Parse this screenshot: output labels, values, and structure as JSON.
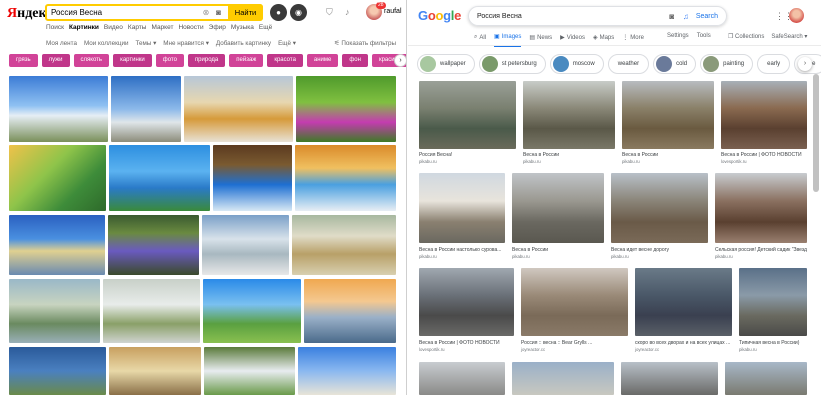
{
  "yandex": {
    "logo_first": "Я",
    "logo_rest": "ндекс",
    "search_value": "Россия Весна",
    "search_button": "Найти",
    "user_name": "raufal",
    "notification_count": "28",
    "services": [
      "Поиск",
      "Картинки",
      "Видео",
      "Карты",
      "Маркет",
      "Новости",
      "Эфир",
      "Музыка",
      "Ещё"
    ],
    "subnav": [
      "Моя лента",
      "Мои коллекции",
      "Темы ▾",
      "Мне нравится ▾",
      "Добавить картинку",
      "Ещё ▾"
    ],
    "filters_label": "Показать фильтры",
    "tags": [
      "грязь",
      "лужи",
      "слякоть",
      "картинки",
      "фото",
      "природа",
      "пейзаж",
      "красота",
      "аниме",
      "фон",
      "красивые"
    ],
    "arrow": "›"
  },
  "google": {
    "logo": [
      "G",
      "o",
      "o",
      "g",
      "l",
      "e"
    ],
    "logo_colors": [
      "#4285f4",
      "#ea4335",
      "#fbbc05",
      "#4285f4",
      "#34a853",
      "#ea4335"
    ],
    "search_value": "Россия Весна",
    "search_button": "Search",
    "tabs": [
      "All",
      "Images",
      "News",
      "Videos",
      "Maps",
      "More"
    ],
    "settings": "Settings",
    "tools": "Tools",
    "collections": "Collections",
    "safesearch": "SafeSearch ▾",
    "chips": [
      "wallpaper",
      "st petersburg",
      "moscow",
      "weather",
      "cold",
      "painting",
      "early",
      "time"
    ],
    "results": [
      {
        "caption": "Россия Весна!",
        "source": "pikabu.ru"
      },
      {
        "caption": "Весна в России",
        "source": "pikabu.ru"
      },
      {
        "caption": "Весна в России",
        "source": "pikabu.ru"
      },
      {
        "caption": "Весна в России | ФОТО НОВОСТИ",
        "source": "lovesportik.ru"
      },
      {
        "caption": "Весна в России настолько сурова...",
        "source": "pikabu.ru"
      },
      {
        "caption": "Весна в России",
        "source": "pikabu.ru"
      },
      {
        "caption": "Весна идет весне дорогу",
        "source": "pikabu.ru"
      },
      {
        "caption": "Сельская россия! Детский садик \"Звезд...",
        "source": "pikabu.ru"
      },
      {
        "caption": "Весна в России | ФОТО НОВОСТИ",
        "source": "lovesportik.ru"
      },
      {
        "caption": "Россия :: весна :: Bear Grylls ...",
        "source": "joyreactor.cc"
      },
      {
        "caption": "скоро во всех дворах и на всех улицах ...",
        "source": "joyreactor.cc"
      },
      {
        "caption": "Типичная весна в России)",
        "source": "pikabu.ru"
      }
    ]
  }
}
